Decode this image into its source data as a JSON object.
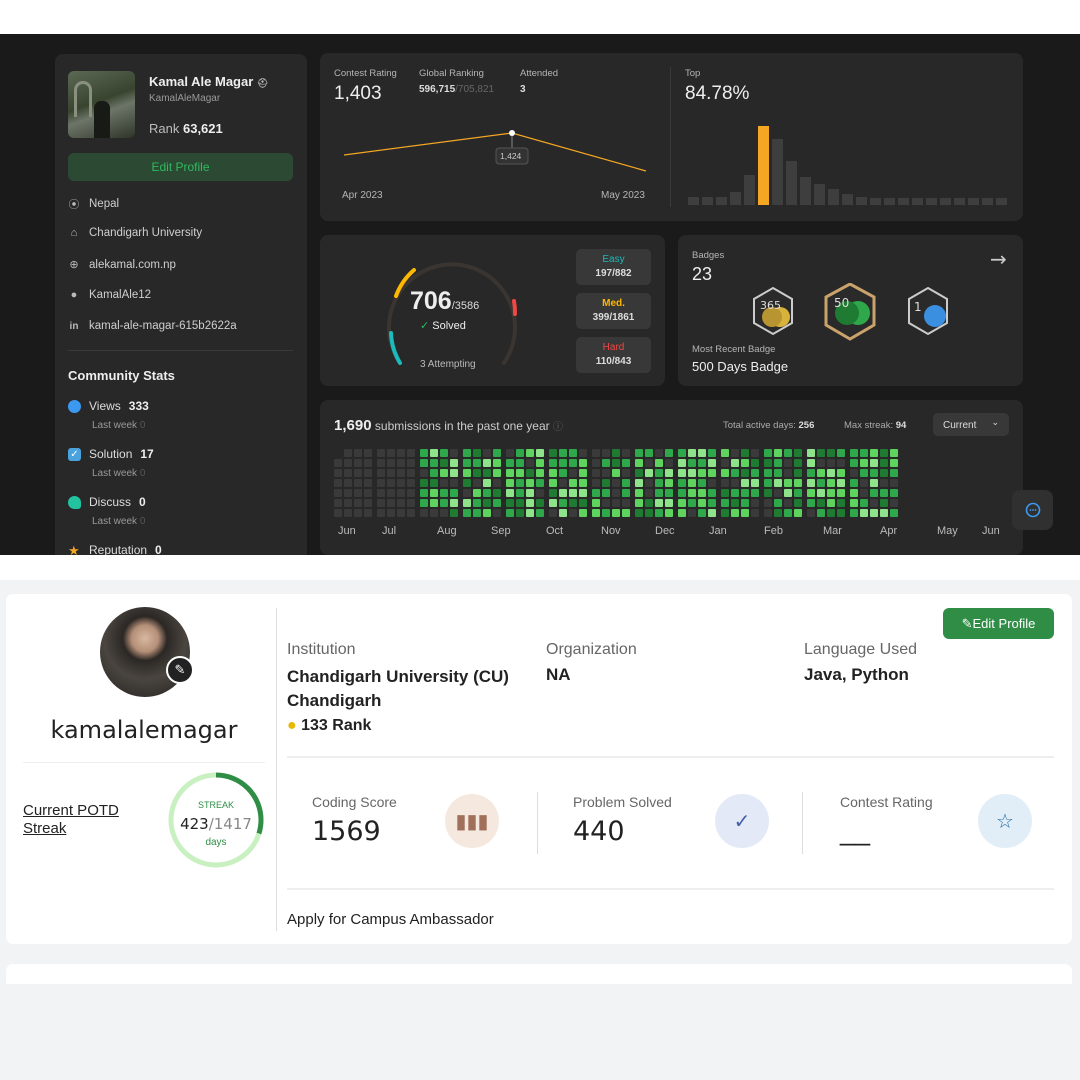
{
  "leetcode": {
    "name": "Kamal Ale Magar",
    "handle": "KamalAleMagar",
    "rank_label": "Rank",
    "rank_value": "63,621",
    "edit_profile": "Edit Profile",
    "info": [
      {
        "icon": "location-icon",
        "text": "Nepal"
      },
      {
        "icon": "school-icon",
        "text": "Chandigarh University"
      },
      {
        "icon": "globe-icon",
        "text": "alekamal.com.np"
      },
      {
        "icon": "github-icon",
        "text": "KamalAle12"
      },
      {
        "icon": "linkedin-icon",
        "text": "kamal-ale-magar-615b2622a"
      }
    ],
    "community_title": "Community Stats",
    "community": [
      {
        "label": "Views",
        "value": "333",
        "sub": "Last week",
        "delta": "0",
        "color": "#3b9af0"
      },
      {
        "label": "Solution",
        "value": "17",
        "sub": "Last week",
        "delta": "0",
        "color": "#4aa3df"
      },
      {
        "label": "Discuss",
        "value": "0",
        "sub": "Last week",
        "delta": "0",
        "color": "#22c4a0"
      },
      {
        "label": "Reputation",
        "value": "0",
        "color": "#f5a623"
      }
    ],
    "contest": {
      "rating_label": "Contest Rating",
      "rating": "1,403",
      "global_label": "Global Ranking",
      "global": "596,715",
      "global_total": "/705,821",
      "attended_label": "Attended",
      "attended": "3",
      "tooltip": "1,424",
      "x_start": "Apr 2023",
      "x_end": "May 2023",
      "top_label": "Top",
      "top": "84.78%"
    },
    "solved": {
      "count": "706",
      "total": "/3586",
      "solved_label": "Solved",
      "attempting": "3 Attempting",
      "easy_label": "Easy",
      "easy": "197/882",
      "med_label": "Med.",
      "med": "399/1861",
      "hard_label": "Hard",
      "hard": "110/843"
    },
    "badges": {
      "label": "Badges",
      "count": "23",
      "recent_label": "Most Recent Badge",
      "recent": "500 Days Badge"
    },
    "heatmap": {
      "count": "1,690",
      "text": "submissions in the past one year",
      "active_label": "Total active days:",
      "active": "256",
      "streak_label": "Max streak:",
      "streak": "94",
      "select": "Current",
      "months": [
        "Jun",
        "Jul",
        "Aug",
        "Sep",
        "Oct",
        "Nov",
        "Dec",
        "Jan",
        "Feb",
        "Mar",
        "Apr",
        "May",
        "Jun"
      ]
    }
  },
  "gfg": {
    "username": "kamalalemagar",
    "edit_profile": "Edit Profile",
    "potd_label": "Current POTD Streak",
    "streak_label": "STREAK",
    "streak_cur": "423",
    "streak_total": "/1417",
    "streak_unit": "days",
    "streak_fraction": 0.298,
    "institution_label": "Institution",
    "institution": "Chandigarh University (CU) Chandigarh",
    "rank": "133 Rank",
    "organization_label": "Organization",
    "organization": "NA",
    "language_label": "Language Used",
    "language": "Java, Python",
    "coding_score_label": "Coding Score",
    "coding_score": "1569",
    "problem_solved_label": "Problem Solved",
    "problem_solved": "440",
    "contest_rating_label": "Contest Rating",
    "contest_rating": "__",
    "ambassador": "Apply for Campus Ambassador"
  }
}
